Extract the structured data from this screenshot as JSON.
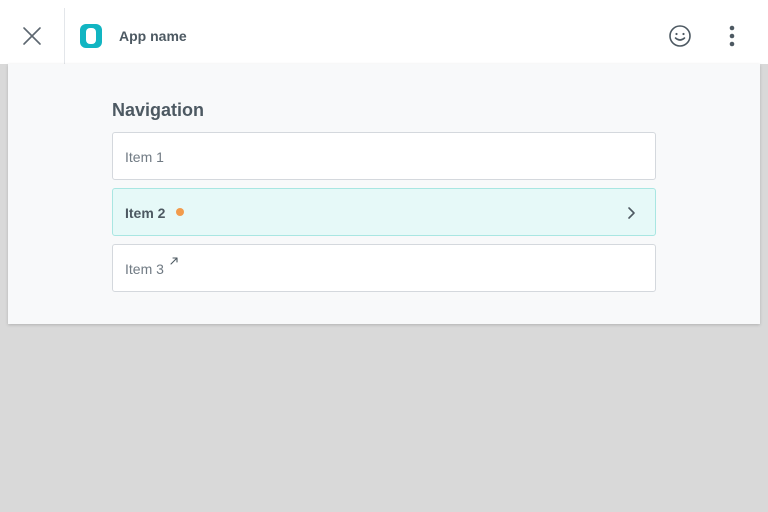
{
  "header": {
    "app_name": "App name",
    "brand_color": "#12b5c2",
    "icons": {
      "close": "close-icon",
      "logo": "app-logo-icon",
      "feedback": "smiley-icon",
      "more": "more-vertical-icon"
    }
  },
  "navigation": {
    "title": "Navigation",
    "items": [
      {
        "label": "Item 1"
      },
      {
        "label": "Item 2",
        "active": true,
        "status_dot_color": "#f29b4c",
        "trailing_icon": "chevron-right-icon"
      },
      {
        "label": "Item 3",
        "trailing_icon": "external-link-icon"
      }
    ]
  }
}
